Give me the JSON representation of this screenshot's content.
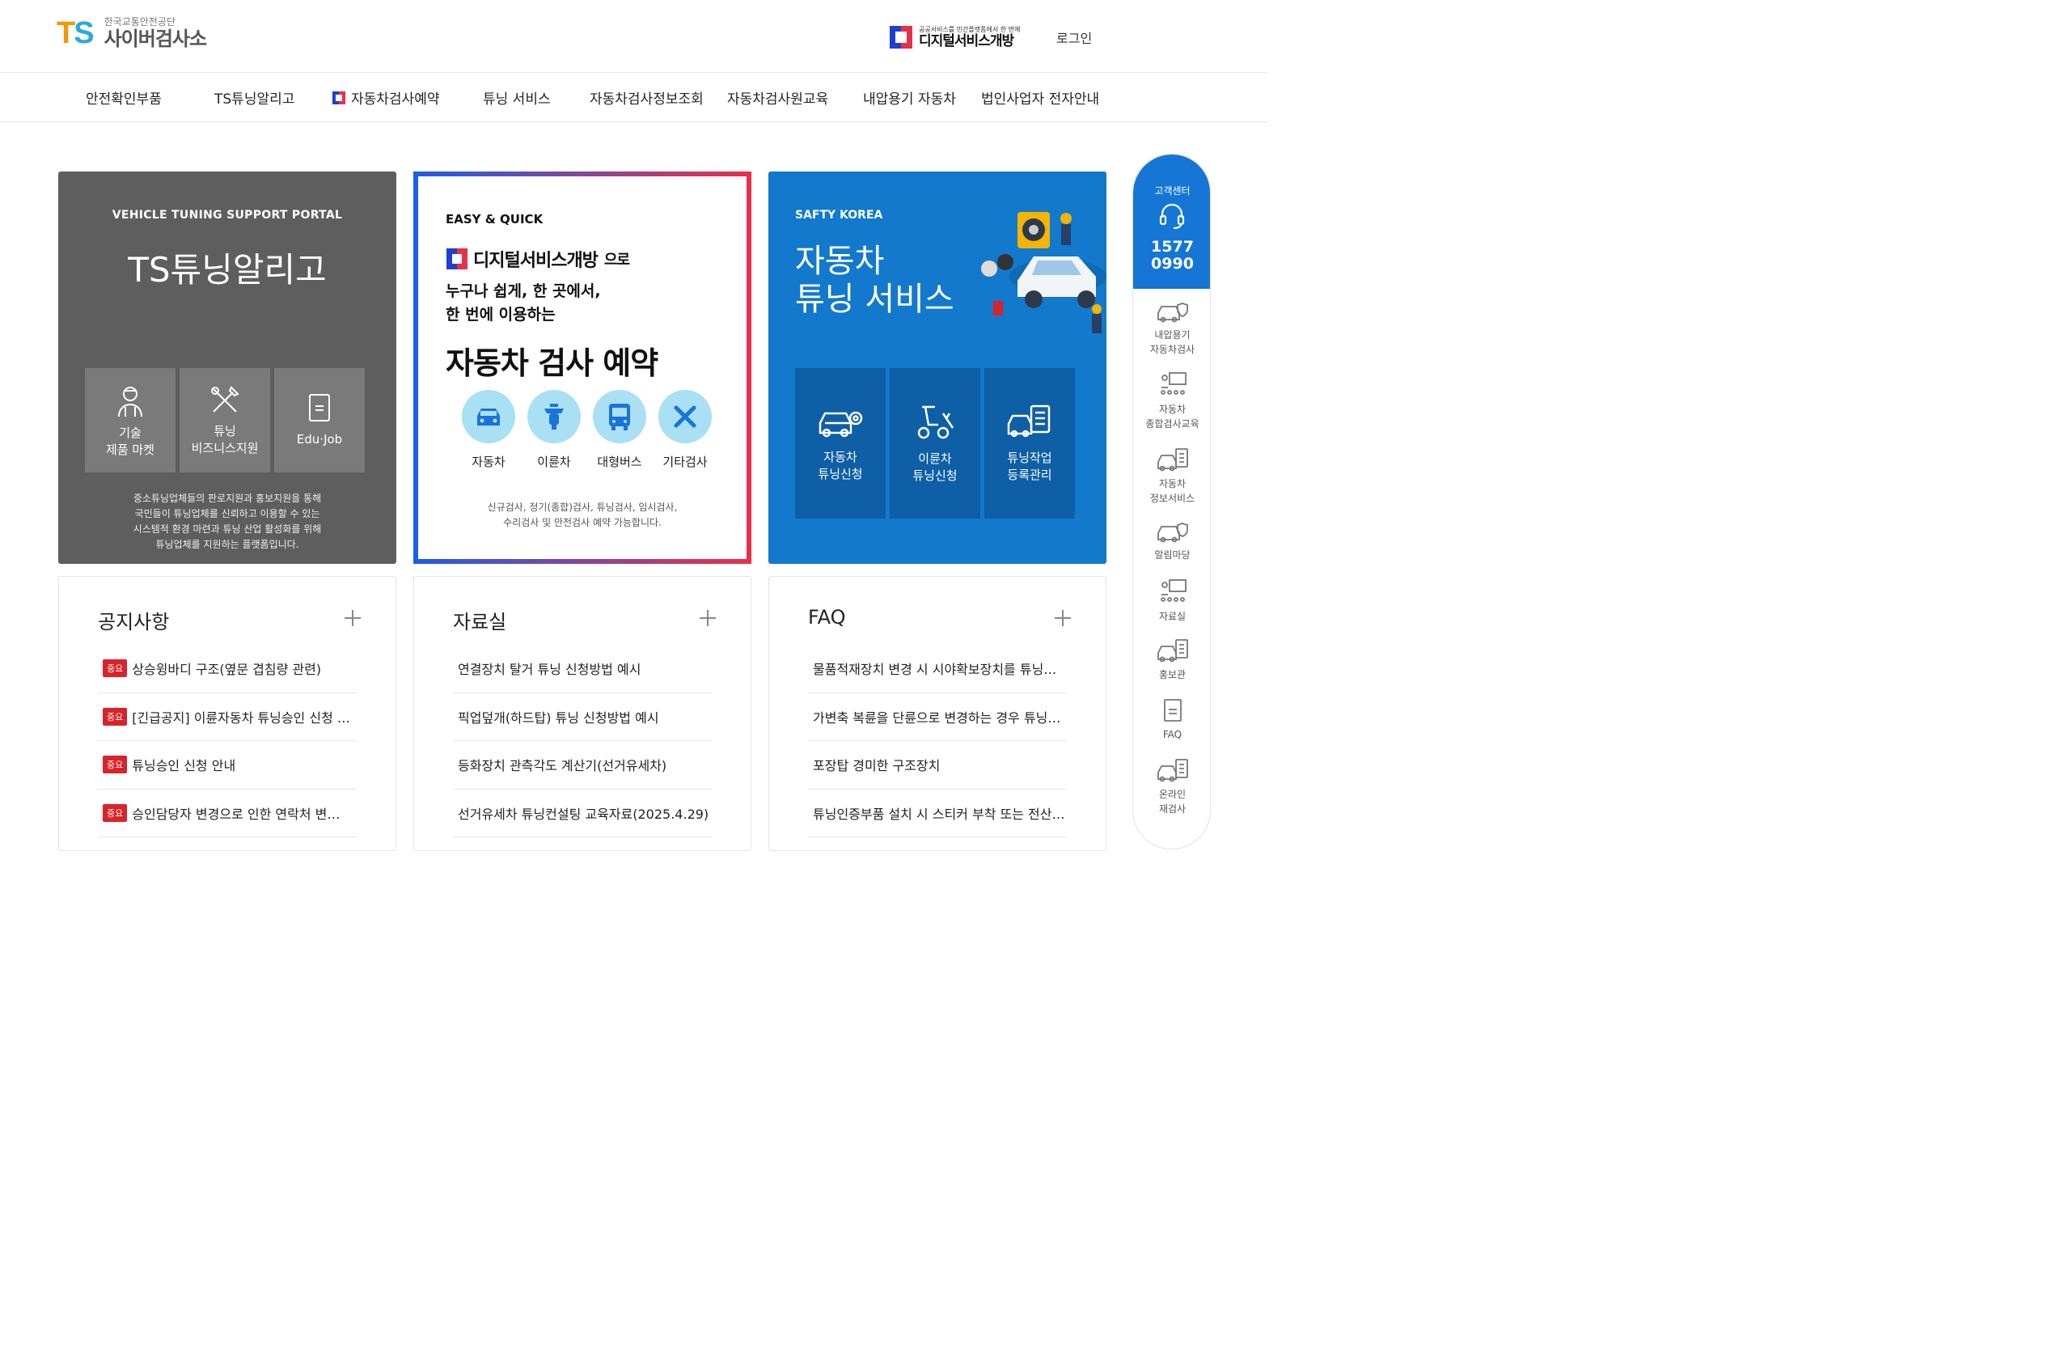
{
  "header": {
    "logo_mark": "TS",
    "logo_org": "한국교통안전공단",
    "logo_title": "사이버검사소",
    "ds_small": "공공서비스를 민간플랫폼에서 한 번에",
    "ds_title": "디지털서비스개방",
    "login": "로그인"
  },
  "nav": [
    "안전확인부품",
    "TS튜닝알리고",
    "자동차검사예약",
    "튜닝 서비스",
    "자동차검사정보조회",
    "자동차검사원교육",
    "내압용기 자동차",
    "법인사업자 전자안내"
  ],
  "card1": {
    "subtitle": "VEHICLE TUNING SUPPORT PORTAL",
    "title": "TS튜닝알리고",
    "tiles": [
      {
        "line1": "기술",
        "line2": "제품 마켓"
      },
      {
        "line1": "튜닝",
        "line2": "비즈니스지원"
      },
      {
        "line1": "Edu·Job",
        "line2": ""
      }
    ],
    "desc": [
      "중소튜닝업체들의 판로지원과 홍보지원을 통해",
      "국민들이 튜닝업체를 신뢰하고 이용할 수 있는",
      "시스템적 환경 마련과 튜닝 산업 활성화를 위해",
      "튜닝업체를 지원하는 플랫폼입니다."
    ]
  },
  "card2": {
    "easy": "EASY & QUICK",
    "ds_title": "디지털서비스개방",
    "ds_suffix": "으로",
    "lead1": "누구나 쉽게, 한 곳에서,",
    "lead2": "한 번에 이용하는",
    "title": "자동차 검사 예약",
    "circles": [
      "자동차",
      "이륜차",
      "대형버스",
      "기타검사"
    ],
    "desc1": "신규검사, 정기(종합)검사, 튜닝검사, 임시검사,",
    "desc2": "수리검사 및 안전검사 예약 가능합니다."
  },
  "card3": {
    "subtitle": "SAFTY KOREA",
    "title1": "자동차",
    "title2": "튜닝 서비스",
    "tiles": [
      {
        "line1": "자동차",
        "line2": "튜닝신청"
      },
      {
        "line1": "이륜차",
        "line2": "튜닝신청"
      },
      {
        "line1": "튜닝작업",
        "line2": "등록관리"
      }
    ]
  },
  "boards": [
    {
      "title": "공지사항",
      "items": [
        {
          "tag": "중요",
          "text": "상승윙바디 구조(옆문 겹침량 관련)"
        },
        {
          "tag": "중요",
          "text": "[긴급공지] 이륜자동차 튜닝승인 신청 …"
        },
        {
          "tag": "중요",
          "text": "튜닝승인 신청 안내"
        },
        {
          "tag": "중요",
          "text": "승인담당자 변경으로 인한 연락처 변…"
        }
      ]
    },
    {
      "title": "자료실",
      "items": [
        {
          "text": "연결장치 탈거 튜닝 신청방법 예시"
        },
        {
          "text": "픽업덮개(하드탑) 튜닝 신청방법 예시"
        },
        {
          "text": "등화장치 관측각도 계산기(선거유세차)"
        },
        {
          "text": "선거유세차 튜닝컨설팅 교육자료(2025.4.29)"
        }
      ]
    },
    {
      "title": "FAQ",
      "items": [
        {
          "text": "물품적재장치 변경 시 시야확보장치를 튜닝…"
        },
        {
          "text": "가변축 복륜을 단륜으로 변경하는 경우 튜닝…"
        },
        {
          "text": "포장탑 경미한 구조장치"
        },
        {
          "text": "튜닝인증부품 설치 시 스티커 부착 또는 전산…"
        }
      ]
    }
  ],
  "side": {
    "label": "고객센터",
    "phone1": "1577",
    "phone2": "0990",
    "items": [
      {
        "line1": "내압용기",
        "line2": "자동차검사"
      },
      {
        "line1": "자동차",
        "line2": "종합검사교육"
      },
      {
        "line1": "자동차",
        "line2": "정보서비스"
      },
      {
        "line1": "알림마당",
        "line2": ""
      },
      {
        "line1": "자료실",
        "line2": ""
      },
      {
        "line1": "홍보관",
        "line2": ""
      },
      {
        "line1": "FAQ",
        "line2": ""
      },
      {
        "line1": "온라인",
        "line2": "재검사"
      }
    ]
  }
}
